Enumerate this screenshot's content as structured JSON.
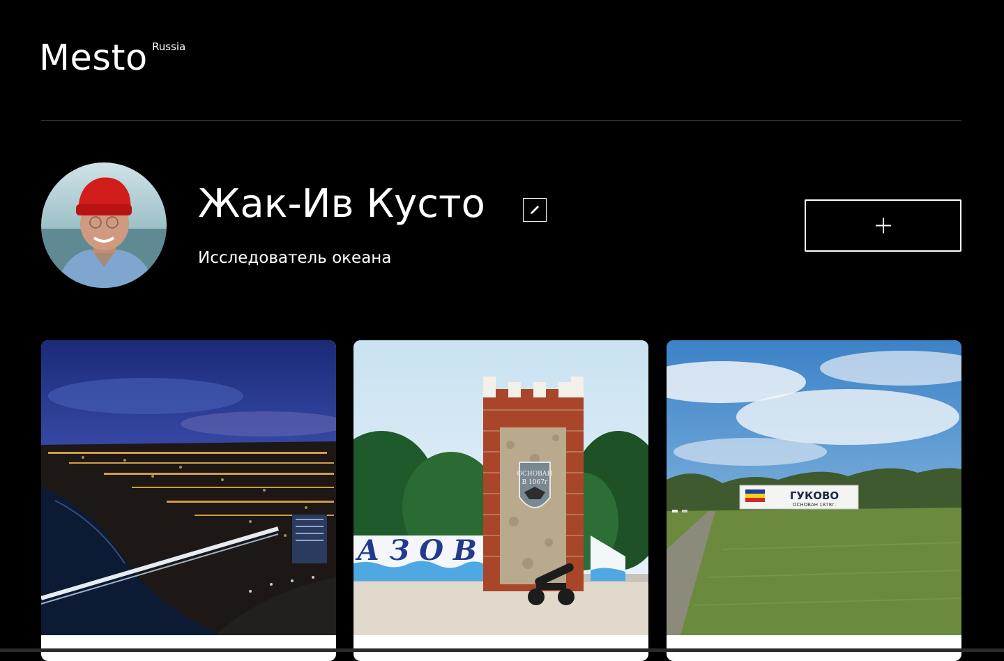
{
  "header": {
    "logo": "Mesto",
    "logo_sup": "Russia"
  },
  "profile": {
    "name": "Жак-Ив Кусто",
    "about": "Исследователь океана",
    "avatar_alt": "avatar",
    "edit_icon": "pencil-icon",
    "add_icon": "plus-icon"
  },
  "cards": [
    {
      "image_alt": "night city by a river"
    },
    {
      "image_alt": "АЗОВ",
      "sign_text": "АЗОВ",
      "plaque_text": "ОСНОВАН В 1067г"
    },
    {
      "image_alt": "ГУКОВО",
      "sign_text": "ГУКОВО",
      "sign_subtext": "ОСНОВАН 1878г."
    }
  ],
  "colors": {
    "background": "#000000",
    "text": "#ffffff",
    "divider": "#545454"
  }
}
